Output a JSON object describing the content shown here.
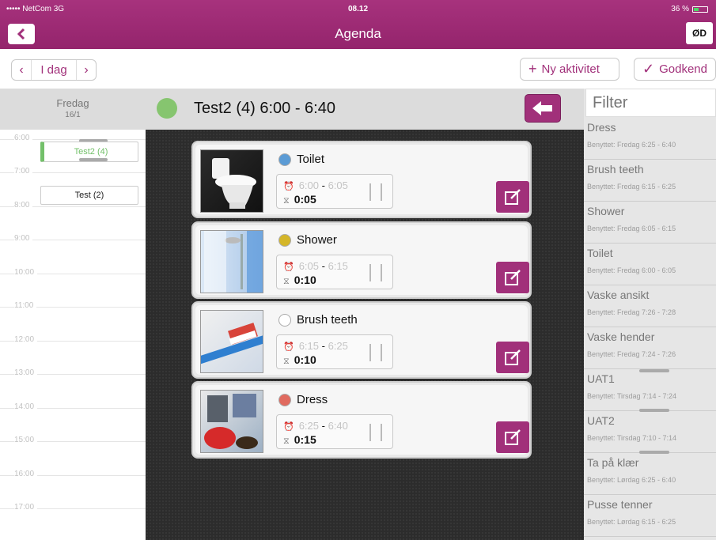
{
  "status_bar": {
    "carrier": "••••• NetCom  3G",
    "time": "08.12",
    "battery": "36 %"
  },
  "nav": {
    "title": "Agenda",
    "user_initials": "ØD"
  },
  "toolbar": {
    "today_label": "I dag",
    "new_activity_label": "Ny aktivitet",
    "approve_label": "Godkend"
  },
  "calendar": {
    "day_name": "Fredag",
    "day_date": "16/1",
    "hours": [
      "6:00",
      "7:00",
      "8:00",
      "9:00",
      "10:00",
      "11:00",
      "12:00",
      "13:00",
      "14:00",
      "15:00",
      "16:00",
      "17:00"
    ],
    "events": [
      {
        "label": "Test2 (4)",
        "active": true
      },
      {
        "label": "Test (2)",
        "active": false
      }
    ]
  },
  "main": {
    "title": "Test2 (4) 6:00 - 6:40",
    "status_color": "#86c56f",
    "activities": [
      {
        "name": "Toilet",
        "dot_color": "#5b9bd5",
        "start": "6:00",
        "end": "6:05",
        "duration": "0:05",
        "image": "toilet"
      },
      {
        "name": "Shower",
        "dot_color": "#d4b629",
        "start": "6:05",
        "end": "6:15",
        "duration": "0:10",
        "image": "shower"
      },
      {
        "name": "Brush teeth",
        "dot_color": "#ffffff",
        "start": "6:15",
        "end": "6:25",
        "duration": "0:10",
        "image": "toothbrush"
      },
      {
        "name": "Dress",
        "dot_color": "#e06a5f",
        "start": "6:25",
        "end": "6:40",
        "duration": "0:15",
        "image": "clothes"
      }
    ]
  },
  "filter": {
    "placeholder": "Filter",
    "items": [
      {
        "name": "Dress",
        "sub": "Benyttet: Fredag 6:25 - 6:40"
      },
      {
        "name": "Brush teeth",
        "sub": "Benyttet: Fredag 6:15 - 6:25"
      },
      {
        "name": "Shower",
        "sub": "Benyttet: Fredag 6:05 - 6:15"
      },
      {
        "name": "Toilet",
        "sub": "Benyttet: Fredag 6:00 - 6:05"
      },
      {
        "name": "Vaske ansikt",
        "sub": "Benyttet: Fredag 7:26 - 7:28"
      },
      {
        "name": "Vaske hender",
        "sub": "Benyttet: Fredag 7:24 - 7:26"
      },
      {
        "name": "UAT1",
        "sub": "Benyttet: Tirsdag 7:14 - 7:24"
      },
      {
        "name": "UAT2",
        "sub": "Benyttet: Tirsdag 7:10 - 7:14"
      },
      {
        "name": "Ta på klær",
        "sub": "Benyttet: Lørdag 6:25 - 6:40"
      },
      {
        "name": "Pusse tenner",
        "sub": "Benyttet: Lørdag 6:15 - 6:25"
      }
    ]
  },
  "colors": {
    "brand": "#a1307a",
    "dark_bg": "#2c2c2c"
  }
}
